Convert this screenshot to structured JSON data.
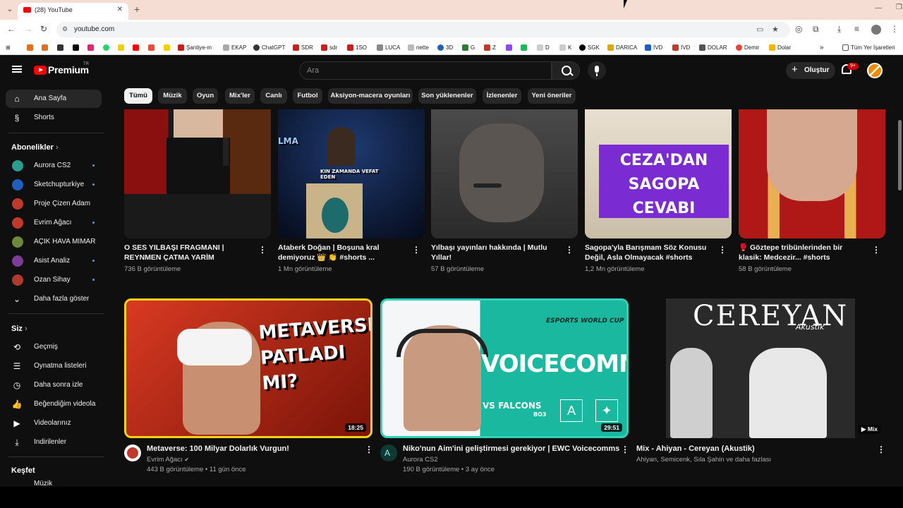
{
  "browser": {
    "tab_title": "(28) YouTube",
    "url": "youtube.com",
    "bookmarks": [
      "Şantiye-m",
      "EKAP",
      "ChatGPT",
      "SDR",
      "sdr",
      "1SO",
      "LUCA",
      "nette",
      "3D",
      "G",
      "Z",
      "D",
      "K",
      "SGK",
      "DARICA",
      "İVD",
      "İVD",
      "DOLAR",
      "Demir",
      "Dolar"
    ],
    "other_bookmarks": "Tüm Yer İşaretleri"
  },
  "youtube": {
    "logo": "Premium",
    "logo_sup": "TR",
    "search_placeholder": "Ara",
    "create_label": "Oluştur",
    "notif_badge": "9+"
  },
  "sidebar": {
    "home": "Ana Sayfa",
    "shorts": "Shorts",
    "subs_head": "Abonelikler",
    "subs": [
      {
        "name": "Aurora CS2",
        "color": "#2a9d8f"
      },
      {
        "name": "Sketchupturkiye",
        "color": "#1e5fbf"
      },
      {
        "name": "Proje Çizen Adam",
        "color": "#c0392b"
      },
      {
        "name": "Evrim Ağacı",
        "color": "#c0392b"
      },
      {
        "name": "AÇIK HAVA MİMARLIK",
        "color": "#6d8a3a"
      },
      {
        "name": "Asist Analiz",
        "color": "#7d3c98"
      },
      {
        "name": "Ozan Sihay",
        "color": "#b03a2e"
      }
    ],
    "more": "Daha fazla göster",
    "you_head": "Siz",
    "you_items": [
      "Geçmiş",
      "Oynatma listeleri",
      "Daha sonra izle",
      "Beğendiğim videolar",
      "Videolarınız",
      "İndirilenler"
    ],
    "explore_head": "Keşfet",
    "explore_partial": "Müzik"
  },
  "chips": [
    "Tümü",
    "Müzik",
    "Oyun",
    "Mix'ler",
    "Canlı",
    "Futbol",
    "Aksiyon-macera oyunları",
    "Son yüklenenler",
    "İzlenenler",
    "Yeni öneriler"
  ],
  "shorts": [
    {
      "title": "O SES YILBAŞI FRAGMANI | REYNMEN ÇATMA YARİM",
      "views": "736 B görüntüleme"
    },
    {
      "title": "Ataberk Doğan | Boşuna kral demiyoruz 👑 👏 #shorts ...",
      "views": "1 Mn görüntüleme",
      "overlay": "KIN ZAMANDA VEFAT EDEN",
      "overlay2": "LMA"
    },
    {
      "title": "Yılbaşı yayınları hakkında | Mutlu Yıllar!",
      "views": "57 B görüntüleme"
    },
    {
      "title": "Sagopa'yla Barışmam Söz Konusu Değil, Asla Olmayacak #shorts",
      "views": "1,2 Mn görüntüleme",
      "overlay": [
        "CEZA'DAN",
        "SAGOPA",
        "CEVABI"
      ]
    },
    {
      "title": "🥊 Göztepe tribünlerinden bir klasik: Medcezir... #shorts",
      "views": "58 B görüntüleme"
    }
  ],
  "videos": [
    {
      "title": "Metaverse: 100 Milyar Dolarlık Vurgun!",
      "channel": "Evrim Ağacı",
      "verified": "✔",
      "meta": "443 B görüntüleme • 11 gün önce",
      "duration": "18:25",
      "overlay": [
        "METAVERSE",
        "PATLADI MI?"
      ]
    },
    {
      "title": "Niko'nun Aim'ini geliştirmesi gerekiyor | EWC Voicecomms",
      "channel": "Aurora CS2",
      "meta": "190 B görüntüleme • 3 ay önce",
      "duration": "29:51",
      "overlay": "VOICECOMMS",
      "overlay_top": "ESPORTS WORLD CUP",
      "overlay_vs": "VS FALCONS",
      "overlay_bo": "BO3"
    },
    {
      "title": "Mix - Ahiyan - Cereyan (Akustik)",
      "channel": "Ahiyan, Semicenk, Sıla Şahin ve daha fazlası",
      "meta": "",
      "duration": "Mix",
      "overlay": "CEREYAN",
      "overlay_sub": "Akustik"
    }
  ],
  "colors": {
    "accent": "#ff0000",
    "bg": "#0f0f0f",
    "chip": "#272727"
  }
}
